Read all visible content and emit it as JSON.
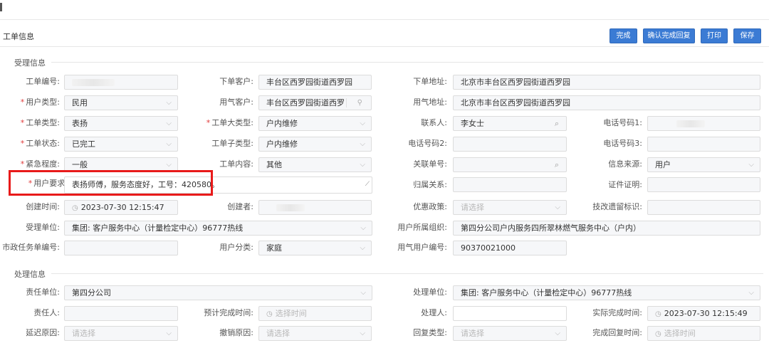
{
  "header": {
    "title": "工单信息",
    "buttons": [
      "完成",
      "确认完成回复",
      "打印",
      "保存"
    ]
  },
  "sections": {
    "accept": "受理信息",
    "process": "处理信息"
  },
  "icons": {
    "chevron": "chevron-down-icon",
    "search": "search-icon",
    "clock": "clock-icon",
    "link": "link-icon",
    "resize": "resize-grip-icon"
  },
  "accept": {
    "work_order_no": {
      "label": "工单编号:"
    },
    "order_customer": {
      "label": "下单客户:",
      "value": "丰台区西罗园街道西罗园"
    },
    "order_address": {
      "label": "下单地址:",
      "value": "北京市丰台区西罗园街道西罗园"
    },
    "user_type": {
      "label": "用户类型:",
      "value": "民用"
    },
    "gas_customer": {
      "label": "用气客户:",
      "value": "丰台区西罗园街道西罗"
    },
    "gas_address": {
      "label": "用气地址:",
      "value": "北京市丰台区西罗园街道西罗园"
    },
    "order_type": {
      "label": "工单类型:",
      "value": "表扬"
    },
    "order_major_type": {
      "label": "工单大类型:",
      "value": "户内维修"
    },
    "contact": {
      "label": "联系人:",
      "value": "李女士"
    },
    "phone1": {
      "label": "电话号码1:"
    },
    "order_status": {
      "label": "工单状态:",
      "value": "已完工"
    },
    "order_sub_type": {
      "label": "工单子类型:",
      "value": "户内维修"
    },
    "phone2": {
      "label": "电话号码2:"
    },
    "phone3": {
      "label": "电话号码3:"
    },
    "urgency": {
      "label": "紧急程度:",
      "value": "一般"
    },
    "order_content": {
      "label": "工单内容:",
      "value": "其他"
    },
    "related_no": {
      "label": "关联单号:"
    },
    "info_source": {
      "label": "信息来源:",
      "value": "用户"
    },
    "user_request": {
      "label": "用户要求:",
      "value": "表扬师傅，服务态度好，工号：420580。"
    },
    "belong_relation": {
      "label": "归属关系:"
    },
    "certificate": {
      "label": "证件证明:"
    },
    "created_time": {
      "label": "创建时间:",
      "value": "2023-07-30 12:15:47"
    },
    "creator": {
      "label": "创建者:"
    },
    "preferential": {
      "label": "优惠政策:",
      "placeholder": "请选择"
    },
    "tech_flag": {
      "label": "技改遗留标识:"
    },
    "accept_unit": {
      "label": "受理单位:",
      "value": "集团: 客户服务中心（计量检定中心）96777热线"
    },
    "user_org": {
      "label": "用户所属组织:",
      "value": "第四分公司户内服务四所翠林燃气服务中心（户内）"
    },
    "city_task_no": {
      "label": "市政任务单编号:"
    },
    "user_category": {
      "label": "用户分类:",
      "value": "家庭"
    },
    "gas_user_no": {
      "label": "用气用户编号:",
      "value": "90370021000"
    }
  },
  "process": {
    "resp_unit": {
      "label": "责任单位:",
      "value": "第四分公司"
    },
    "handle_unit": {
      "label": "处理单位:",
      "value": "集团: 客户服务中心（计量检定中心）96777热线"
    },
    "resp_person": {
      "label": "责任人:"
    },
    "plan_finish": {
      "label": "预计完成时间:",
      "placeholder": "选择时间"
    },
    "handler": {
      "label": "处理人:"
    },
    "actual_finish": {
      "label": "实际完成时间:",
      "value": "2023-07-30 12:15:49"
    },
    "delay_reason": {
      "label": "延迟原因:",
      "placeholder": "请选择"
    },
    "cancel_reason": {
      "label": "撤销原因:",
      "placeholder": "请选择"
    },
    "reply_type": {
      "label": "回复类型:",
      "placeholder": "请选择"
    },
    "finish_reply_time": {
      "label": "完成回复时间:",
      "placeholder": "选择时间"
    }
  },
  "colors": {
    "primary_button": "#3b7bd4",
    "required_star": "#e03b3b",
    "highlight_box": "#e81a1a"
  }
}
